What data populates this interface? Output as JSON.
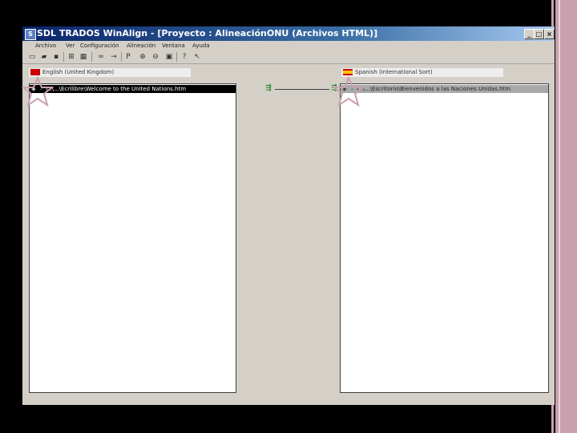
{
  "window": {
    "title": "SDL TRADOS WinAlign - [Proyecto : AlineaciónONU (Archivos HTML)]",
    "controls": {
      "minimize": "_",
      "maximize": "□",
      "close": "×"
    }
  },
  "menubar": {
    "items": [
      "Archivo",
      "Ver",
      "Configuración",
      "Alineación",
      "Ventana",
      "Ayuda"
    ]
  },
  "toolbar": {
    "buttons": [
      "new-icon",
      "open-icon",
      "save-icon",
      "tree-icon",
      "properties-icon",
      "binoculars-icon",
      "arrow-icon",
      "p-icon",
      "zoom-in-icon",
      "zoom-out-icon",
      "fit-icon",
      "help-icon",
      "help-context-icon"
    ]
  },
  "source": {
    "language": "English (United Kingdom)",
    "file": "C:\\...\\Ecrilibre\\Welcome to the United Nations.htm"
  },
  "target": {
    "language": "Spanish (International Sort)",
    "file": "C:\\...\\Escritorio\\Bienvenidos a las Naciones Unidas.htm"
  },
  "colors": {
    "titlebar": "#0a246a",
    "highlight": "#000000",
    "check": "#2a8a2a",
    "annotation": "#c9a0ad"
  }
}
